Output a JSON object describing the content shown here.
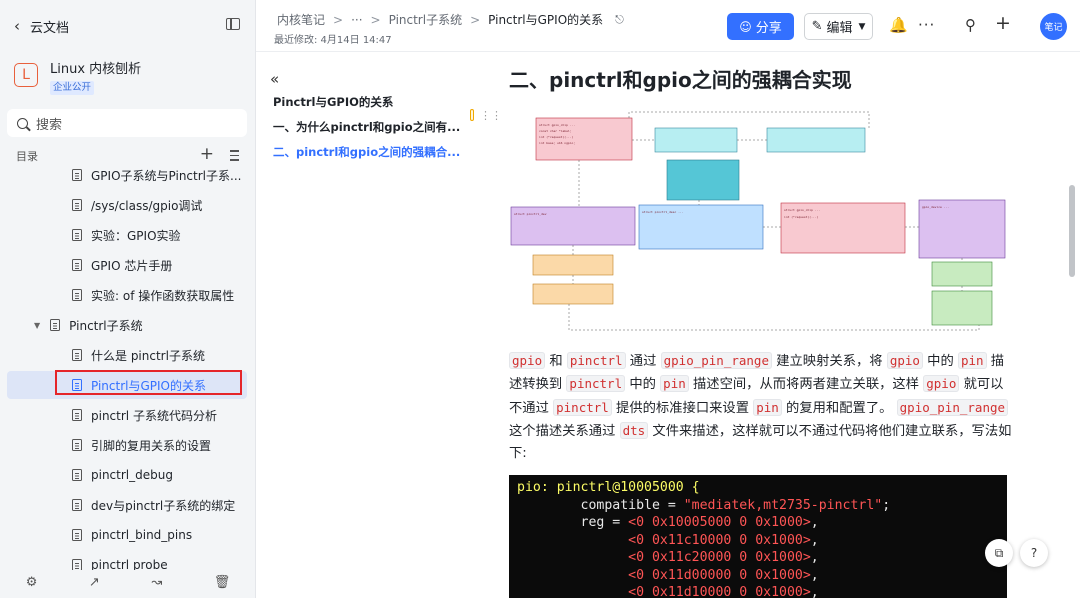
{
  "sidebar": {
    "back_label": "云文档",
    "kb_initial": "L",
    "kb_name": "Linux 内核刨析",
    "kb_badge": "企业公开",
    "search_placeholder": "搜索",
    "toc_label": "目录",
    "items": [
      {
        "label": "GPIO子系统与Pinctrl子系...",
        "type": "doc"
      },
      {
        "label": "/sys/class/gpio调试",
        "type": "doc"
      },
      {
        "label": "实验：GPIO实验",
        "type": "doc"
      },
      {
        "label": "GPIO 芯片手册",
        "type": "doc"
      },
      {
        "label": "实验: of 操作函数获取属性",
        "type": "doc"
      },
      {
        "label": "Pinctrl子系统",
        "type": "folder"
      },
      {
        "label": "什么是 pinctrl子系统",
        "type": "doc"
      },
      {
        "label": "Pinctrl与GPIO的关系",
        "type": "doc",
        "active": true
      },
      {
        "label": "pinctrl 子系统代码分析",
        "type": "doc"
      },
      {
        "label": "引脚的复用关系的设置",
        "type": "doc"
      },
      {
        "label": "pinctrl_debug",
        "type": "doc"
      },
      {
        "label": "dev与pinctrl子系统的绑定",
        "type": "doc"
      },
      {
        "label": "pinctrl_bind_pins",
        "type": "doc"
      },
      {
        "label": "pinctrl probe",
        "type": "doc"
      }
    ],
    "bottom_icons": [
      "settings-icon",
      "share-out-icon",
      "chart-icon",
      "trash-icon"
    ]
  },
  "header": {
    "crumb_root": "内核笔记",
    "crumb_more": "···",
    "crumb_parent": "Pinctrl子系统",
    "crumb_current": "Pinctrl与GPIO的关系",
    "pin_icon": "pin-icon",
    "modified": "最近修改: 4月14日 14:47",
    "share_label": "分享",
    "edit_label": "编辑",
    "avatar_label": "笔记"
  },
  "outline": {
    "title": "Pinctrl与GPIO的关系",
    "item1": "一、为什么pinctrl和gpio之间有...",
    "item2": "二、pinctrl和gpio之间的强耦合..."
  },
  "content": {
    "heading": "二、pinctrl和gpio之间的强耦合实现",
    "para": [
      {
        "t": "code",
        "v": "gpio"
      },
      {
        "t": "text",
        "v": " 和 "
      },
      {
        "t": "code",
        "v": "pinctrl"
      },
      {
        "t": "text",
        "v": " 通过 "
      },
      {
        "t": "code",
        "v": "gpio_pin_range"
      },
      {
        "t": "text",
        "v": " 建立映射关系，将 "
      },
      {
        "t": "code",
        "v": "gpio"
      },
      {
        "t": "text",
        "v": " 中的 "
      },
      {
        "t": "code",
        "v": "pin"
      },
      {
        "t": "text",
        "v": " 描述转换到 "
      },
      {
        "t": "code",
        "v": "pinctrl"
      },
      {
        "t": "text",
        "v": " 中的 "
      },
      {
        "t": "code",
        "v": "pin"
      },
      {
        "t": "text",
        "v": " 描述空间，从而将两者建立关联，这样 "
      },
      {
        "t": "code",
        "v": "gpio"
      },
      {
        "t": "text",
        "v": " 就可以不通过 "
      },
      {
        "t": "code",
        "v": "pinctrl"
      },
      {
        "t": "text",
        "v": " 提供的标准接口来设置 "
      },
      {
        "t": "code",
        "v": "pin"
      },
      {
        "t": "text",
        "v": " 的复用和配置了。 "
      },
      {
        "t": "code",
        "v": "gpio_pin_range"
      },
      {
        "t": "text",
        "v": " 这个描述关系通过 "
      },
      {
        "t": "code",
        "v": "dts"
      },
      {
        "t": "text",
        "v": " 文件来描述，这样就可以不通过代码将他们建立联系，写法如下:"
      }
    ],
    "code_lines": [
      {
        "kw": "pio: pinctrl@10005000 {",
        "rest": ""
      },
      {
        "kw": "",
        "pre": "        compatible = ",
        "str": "\"mediatek,mt2735-pinctrl\"",
        "post": ";"
      },
      {
        "kw": "",
        "pre": "        reg = ",
        "str": "<0 0x10005000 0 0x1000>",
        "post": ","
      },
      {
        "kw": "",
        "pre": "              ",
        "str": "<0 0x11c10000 0 0x1000>",
        "post": ","
      },
      {
        "kw": "",
        "pre": "              ",
        "str": "<0 0x11c20000 0 0x1000>",
        "post": ","
      },
      {
        "kw": "",
        "pre": "              ",
        "str": "<0 0x11d00000 0 0x1000>",
        "post": ","
      },
      {
        "kw": "",
        "pre": "              ",
        "str": "<0 0x11d10000 0 0x1000>",
        "post": ","
      }
    ]
  }
}
